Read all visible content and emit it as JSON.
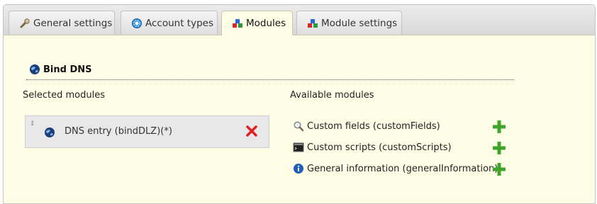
{
  "tabs": [
    {
      "label": "General settings",
      "icon": "wrench-icon"
    },
    {
      "label": "Account types",
      "icon": "gear-icon"
    },
    {
      "label": "Modules",
      "icon": "modules-icon",
      "active": true
    },
    {
      "label": "Module settings",
      "icon": "modules-icon"
    }
  ],
  "section": {
    "title": "Bind DNS",
    "icon": "globe-icon"
  },
  "selected": {
    "label": "Selected modules",
    "items": [
      {
        "label": "DNS entry (bindDLZ)(*)",
        "icon": "globe-icon",
        "action_icon": "remove-icon"
      }
    ]
  },
  "available": {
    "label": "Available modules",
    "items": [
      {
        "label": "Custom fields (customFields)",
        "icon": "magnifier-icon",
        "action_icon": "add-icon"
      },
      {
        "label": "Custom scripts (customScripts)",
        "icon": "terminal-icon",
        "action_icon": "add-icon"
      },
      {
        "label": "General information (generalInformation)",
        "icon": "info-icon",
        "action_icon": "add-icon"
      }
    ]
  },
  "colors": {
    "panel_bg": "#fefee6",
    "remove": "#e02020",
    "add": "#3ea52a",
    "info": "#1f5fb8"
  }
}
